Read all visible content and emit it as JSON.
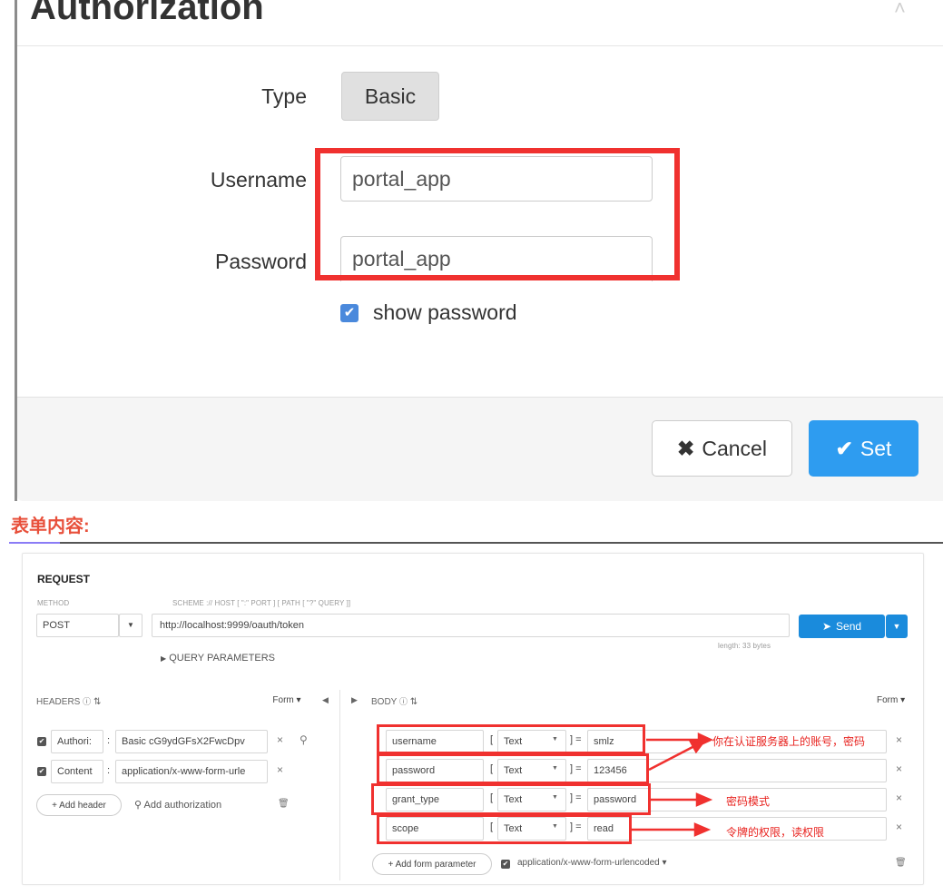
{
  "dialog": {
    "title": "Authorization",
    "close_icon": "close-icon",
    "type_label": "Type",
    "type_value": "Basic",
    "username_label": "Username",
    "username_value": "portal_app",
    "password_label": "Password",
    "password_value": "portal_app",
    "show_password_label": "show password",
    "show_password_checked": true,
    "cancel_label": "Cancel",
    "set_label": "Set",
    "accent_color": "#2e9cf0",
    "highlight_color": "#f0312f"
  },
  "caption": "表单内容:",
  "request": {
    "section_title": "REQUEST",
    "method_label": "METHOD",
    "method_value": "POST",
    "scheme_label": "SCHEME :// HOST [ \":\" PORT ] [ PATH [ \"?\" QUERY ]]",
    "url": "http://localhost:9999/oauth/token",
    "send_label": "Send",
    "length_text": "length: 33 bytes",
    "query_params_label": "QUERY PARAMETERS",
    "headers_label": "HEADERS",
    "headers_form_label": "Form ▾",
    "headers": [
      {
        "name": "Authori:",
        "value": "Basic cG9ydGFsX2FwcDpv"
      },
      {
        "name": "Content",
        "value": "application/x-www-form-urle"
      }
    ],
    "add_header_label": "+ Add header",
    "add_authorization_label": "Add authorization",
    "body_label": "BODY",
    "body_form_label": "Form ▾",
    "body_params": [
      {
        "key": "username",
        "type": "Text",
        "value": "smlz",
        "note": "你在认证服务器上的账号，密码"
      },
      {
        "key": "password",
        "type": "Text",
        "value": "123456",
        "note": ""
      },
      {
        "key": "grant_type",
        "type": "Text",
        "value": "password",
        "note": "密码模式"
      },
      {
        "key": "scope",
        "type": "Text",
        "value": "read",
        "note": "令牌的权限，读权限"
      }
    ],
    "add_form_param_label": "+ Add form parameter",
    "content_type_label": "application/x-www-form-urlencoded ▾"
  }
}
